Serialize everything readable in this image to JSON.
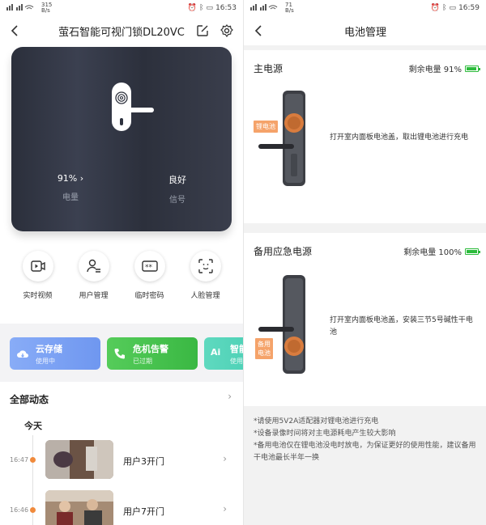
{
  "left": {
    "status": {
      "signal": "4G",
      "speed": "315\nB/s",
      "time": "16:53"
    },
    "header": {
      "title": "萤石智能可视门锁DL20VC"
    },
    "lock": {
      "battery_value": "91%",
      "battery_label": "电量",
      "signal_value": "良好",
      "signal_label": "信号"
    },
    "actions": [
      {
        "label": "实时视频",
        "icon": "video-icon"
      },
      {
        "label": "用户管理",
        "icon": "user-manage-icon"
      },
      {
        "label": "临时密码",
        "icon": "temp-password-icon"
      },
      {
        "label": "人脸管理",
        "icon": "face-manage-icon"
      }
    ],
    "services": [
      {
        "title": "云存储",
        "sub": "使用中",
        "color": "#7aa3f5"
      },
      {
        "title": "危机告警",
        "sub": "已过期",
        "color": "#45c14e"
      },
      {
        "title": "智能",
        "sub": "使用",
        "color": "#3cc9ad"
      }
    ],
    "events": {
      "section": "全部动态",
      "day": "今天",
      "items": [
        {
          "time": "16:47",
          "title": "用户3开门"
        },
        {
          "time": "16:46",
          "title": "用户7开门"
        }
      ]
    }
  },
  "right": {
    "status": {
      "speed": "71\nB/s",
      "time": "16:59"
    },
    "header": {
      "title": "电池管理"
    },
    "main": {
      "name": "主电源",
      "remain": "剩余电量 91%",
      "tag": "锂电池",
      "desc": "打开室内面板电池盖，取出锂电池进行充电",
      "level": 0.91
    },
    "backup": {
      "name": "备用应急电源",
      "remain": "剩余电量 100%",
      "tag": "备用\n电池",
      "desc": "打开室内面板电池盖，安装三节5号碱性干电池",
      "level": 1.0
    },
    "notes": [
      "*请使用5V2A适配器对锂电池进行充电",
      "*设备录像时间将对主电源耗电产生较大影响",
      "*备用电池仅在锂电池没电时放电，为保证更好的使用性能，建议备用干电池最长半年一换"
    ]
  }
}
